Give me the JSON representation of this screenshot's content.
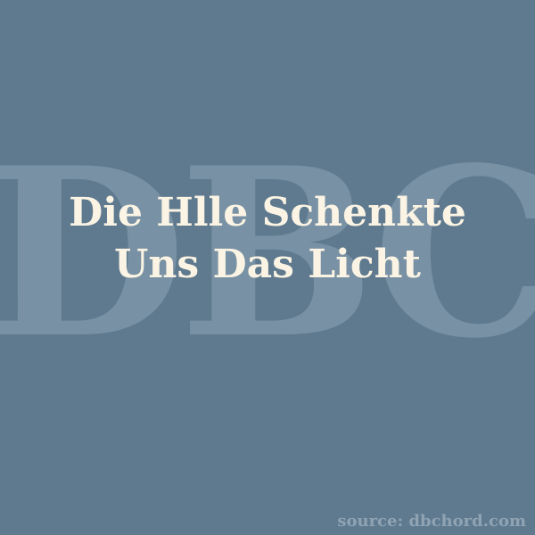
{
  "watermark": {
    "text": "DBC",
    "color": "#7c94a7"
  },
  "title": {
    "line1": "Die Hlle Schenkte",
    "line2": "Uns Das Licht",
    "color": "#fbf4e4"
  },
  "footer": {
    "source": "source: dbchord.com"
  },
  "background_color": "#5f7a8f"
}
